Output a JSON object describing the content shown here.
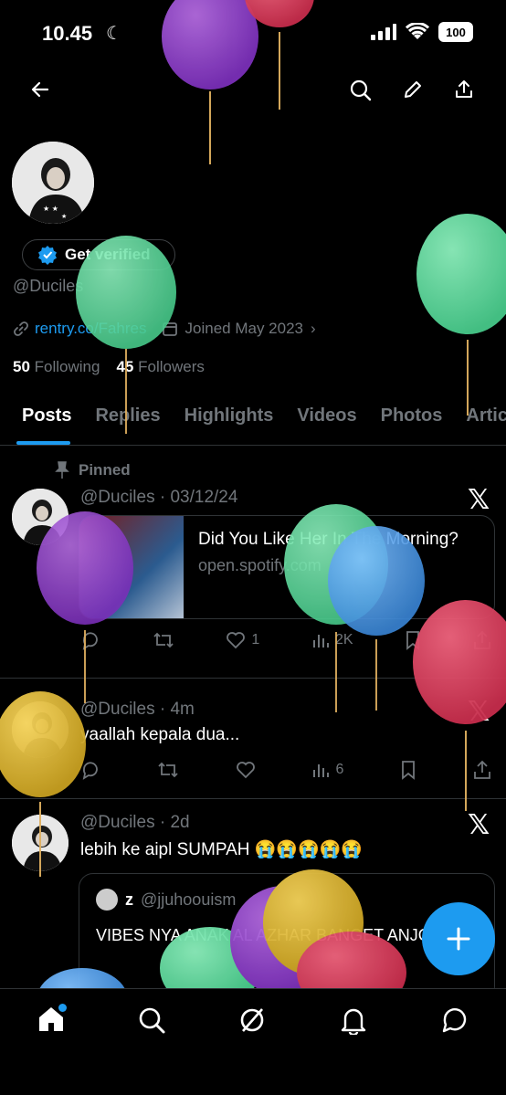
{
  "status_bar": {
    "time": "10.45",
    "battery": "100"
  },
  "profile": {
    "verified_label": "Get verified",
    "handle": "@Duciles",
    "link": "rentry.co/Fahres",
    "joined": "Joined May 2023",
    "following_count": "50",
    "following_label": "Following",
    "followers_count": "45",
    "followers_label": "Followers"
  },
  "tabs": [
    "Posts",
    "Replies",
    "Highlights",
    "Videos",
    "Photos",
    "Articles"
  ],
  "tweets": [
    {
      "pinned_label": "Pinned",
      "handle": "@Duciles",
      "time": "03/12/24",
      "card_title": "Did You Like Her In The Morning?",
      "card_domain": "open.spotify.com",
      "likes": "1",
      "views": "2K"
    },
    {
      "handle": "@Duciles",
      "time": "4m",
      "text": "yaallah kepala dua...",
      "views": "6"
    },
    {
      "handle": "@Duciles",
      "time": "2d",
      "text": "lebih ke aipl SUMPAH 😭😭😭😭😭",
      "quote_name": "z",
      "quote_handle": "@jjuhoouism",
      "quote_text": "VIBES NYA ANAK AL AZHAR BANGET ANJG"
    }
  ],
  "colors": {
    "accent": "#1d9bf0",
    "background": "#000000",
    "muted": "#71767b"
  },
  "icons": [
    "back-arrow-icon",
    "search-icon",
    "pencil-icon",
    "share-icon",
    "home-icon",
    "explore-icon",
    "grok-icon",
    "notifications-icon",
    "messages-icon",
    "plus-icon"
  ]
}
